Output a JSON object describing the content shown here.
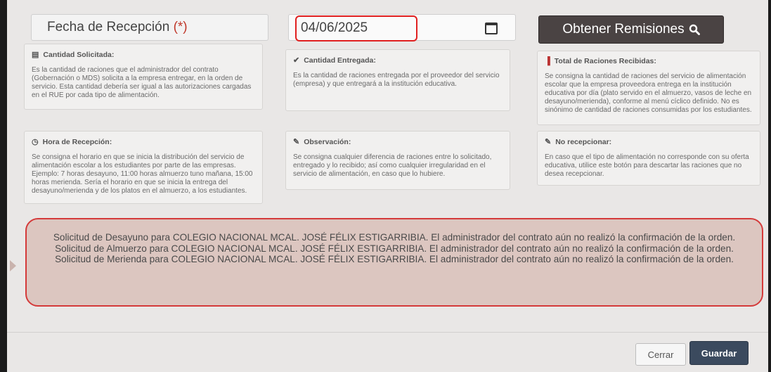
{
  "header": {
    "date_label": "Fecha de Recepción",
    "required_mark": "(*)",
    "date_value": "04/06/2025",
    "obtain_button": "Obtener Remisiones",
    "calendar_icon": "calendar-icon",
    "search_icon": "search-icon"
  },
  "cards": [
    {
      "icon": "table-icon",
      "glyph": "▤",
      "title": "Cantidad Solicitada:",
      "body": "Es la cantidad de raciones que el administrador del contrato (Gobernación o MDS) solicita a la empresa entregar, en la orden de servicio. Esta cantidad debería ser igual a las autorizaciones cargadas en el RUE por cada tipo de alimentación."
    },
    {
      "icon": "check-icon",
      "glyph": "✔",
      "title": "Cantidad Entregada:",
      "body": "Es la cantidad de raciones entregada por el proveedor del servicio (empresa) y que entregará a la institución educativa."
    },
    {
      "icon": "bar-chart-icon",
      "glyph": "▐",
      "title": "Total de Raciones Recibidas:",
      "body": "Se consigna la cantidad de raciones del servicio de alimentación escolar que la empresa proveedora entrega en la institución educativa por día (plato servido en el almuerzo, vasos de leche en desayuno/merienda), conforme al menú cíclico definido. No es sinónimo de cantidad de raciones consumidas por los estudiantes."
    },
    {
      "icon": "clock-icon",
      "glyph": "◷",
      "title": "Hora de Recepción:",
      "body": "Se consigna el horario en que se inicia la distribución del servicio de alimentación escolar a los estudiantes por parte de las empresas. Ejemplo: 7 horas desayuno, 11:00 horas almuerzo tuno mañana, 15:00 horas merienda. Sería el horario en que se inicia la entrega del desayuno/merienda y de los platos en el almuerzo, a los estudiantes."
    },
    {
      "icon": "edit-icon",
      "glyph": "✎",
      "title": "Observación:",
      "body": "Se consigna cualquier diferencia de raciones entre lo solicitado, entregado y lo recibido; así como cualquier irregularidad en el servicio de alimentación, en caso que lo hubiere."
    },
    {
      "icon": "edit-icon",
      "glyph": "✎",
      "title": "No recepcionar:",
      "body": "En caso que el tipo de alimentación no corresponde con su oferta educativa, utilice este botón para descartar las raciones que no desea recepcionar."
    }
  ],
  "alert": {
    "lines": [
      "Solicitud de Desayuno para COLEGIO NACIONAL MCAL. JOSÉ FÉLIX ESTIGARRIBIA. El administrador del contrato aún no realizó la confirmación de la orden.",
      "Solicitud de Almuerzo para COLEGIO NACIONAL MCAL. JOSÉ FÉLIX ESTIGARRIBIA. El administrador del contrato aún no realizó la confirmación de la orden.",
      "Solicitud de Merienda para COLEGIO NACIONAL MCAL. JOSÉ FÉLIX ESTIGARRIBIA. El administrador del contrato aún no realizó la confirmación de la orden."
    ]
  },
  "footer": {
    "close_button": "Cerrar",
    "save_button": "Guardar"
  }
}
